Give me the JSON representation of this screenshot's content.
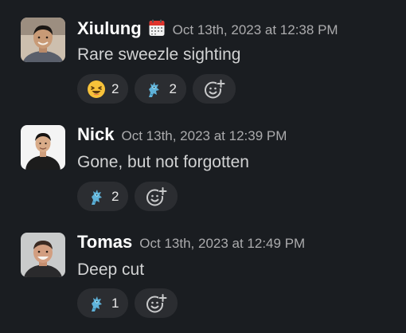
{
  "messages": [
    {
      "author": "Xiulung",
      "status_icon": "calendar-icon",
      "timestamp": "Oct 13th, 2023 at 12:38 PM",
      "text": "Rare sweezle sighting",
      "reactions": [
        {
          "emoji": "laughing-face-icon",
          "count": "2"
        },
        {
          "emoji": "blue-dragon-icon",
          "count": "2"
        }
      ]
    },
    {
      "author": "Nick",
      "timestamp": "Oct 13th, 2023 at 12:39 PM",
      "text": "Gone, but not forgotten",
      "reactions": [
        {
          "emoji": "blue-dragon-icon",
          "count": "2"
        }
      ]
    },
    {
      "author": "Tomas",
      "timestamp": "Oct 13th, 2023 at 12:49 PM",
      "text": "Deep cut",
      "reactions": [
        {
          "emoji": "blue-dragon-icon",
          "count": "1"
        }
      ]
    }
  ],
  "colors": {
    "background": "#1a1d21",
    "author": "#ffffff",
    "timestamp": "#ababad",
    "text": "#d1d2d3",
    "reaction_pill": "#2b2d31"
  }
}
